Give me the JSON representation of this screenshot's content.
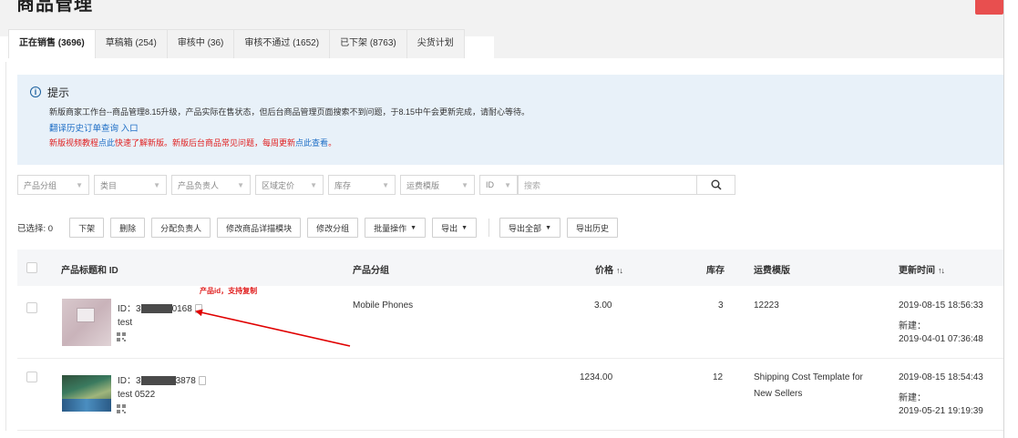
{
  "page": {
    "title": "商品管理"
  },
  "tabs": [
    {
      "label": "正在销售 (3696)",
      "active": true
    },
    {
      "label": "草稿箱 (254)"
    },
    {
      "label": "审核中 (36)"
    },
    {
      "label": "审核不通过 (1652)"
    },
    {
      "label": "已下架 (8763)"
    },
    {
      "label": "尖货计划"
    }
  ],
  "notice": {
    "icon": "info-icon",
    "title": "提示",
    "line1": "新版商家工作台--商品管理8.15升级，产品实际在售状态，但后台商品管理页面搜索不到问题，于8.15中午会更新完成，请耐心等待。",
    "link": "翻译历史订单查询 入口",
    "line3_part1": "新版视频教程",
    "line3_link1": "点此",
    "line3_part2": "快速了解新版。新版后台商品常见问题，每周更新",
    "line3_link2": "点此查看",
    "line3_end": "。"
  },
  "filters": {
    "category_group": "产品分组",
    "category": "类目",
    "owner": "产品负责人",
    "region_price": "区域定价",
    "stock": "库存",
    "shipping_template": "运费模版",
    "id_select": "ID",
    "search_placeholder": "搜索"
  },
  "actions": {
    "selected": "已选择: 0",
    "delist": "下架",
    "delete": "删除",
    "assign_owner": "分配负责人",
    "edit_detail_module": "修改商品详描模块",
    "edit_group": "修改分组",
    "batch": "批量操作",
    "export": "导出",
    "export_all": "导出全部",
    "export_history": "导出历史"
  },
  "table": {
    "headers": {
      "title_id": "产品标题和 ID",
      "group": "产品分组",
      "price": "价格",
      "stock": "库存",
      "shipping": "运费模版",
      "updated": "更新时间"
    },
    "rows": [
      {
        "id_prefix": "ID：3",
        "id_suffix": "0168",
        "title": "test",
        "group": "Mobile Phones",
        "price": "3.00",
        "stock": "3",
        "shipping": "12223",
        "updated": "2019-08-15 18:56:33",
        "created_label": "新建：",
        "created": "2019-04-01 07:36:48"
      },
      {
        "id_prefix": "ID：3",
        "id_suffix": "3878",
        "title": "test 0522",
        "group": "",
        "price": "1234.00",
        "stock": "12",
        "shipping_line1": "Shipping Cost Template for",
        "shipping_line2": "New Sellers",
        "updated": "2019-08-15 18:54:43",
        "created_label": "新建：",
        "created": "2019-05-21 19:19:39"
      }
    ]
  },
  "annotation": {
    "text": "产品id，支持复制",
    "color": "#e02020"
  },
  "colors": {
    "notice_bg": "#e8f1f9",
    "link": "#1f6fc6",
    "warning_text": "#e02020",
    "header_bg": "#f5f6f8"
  }
}
